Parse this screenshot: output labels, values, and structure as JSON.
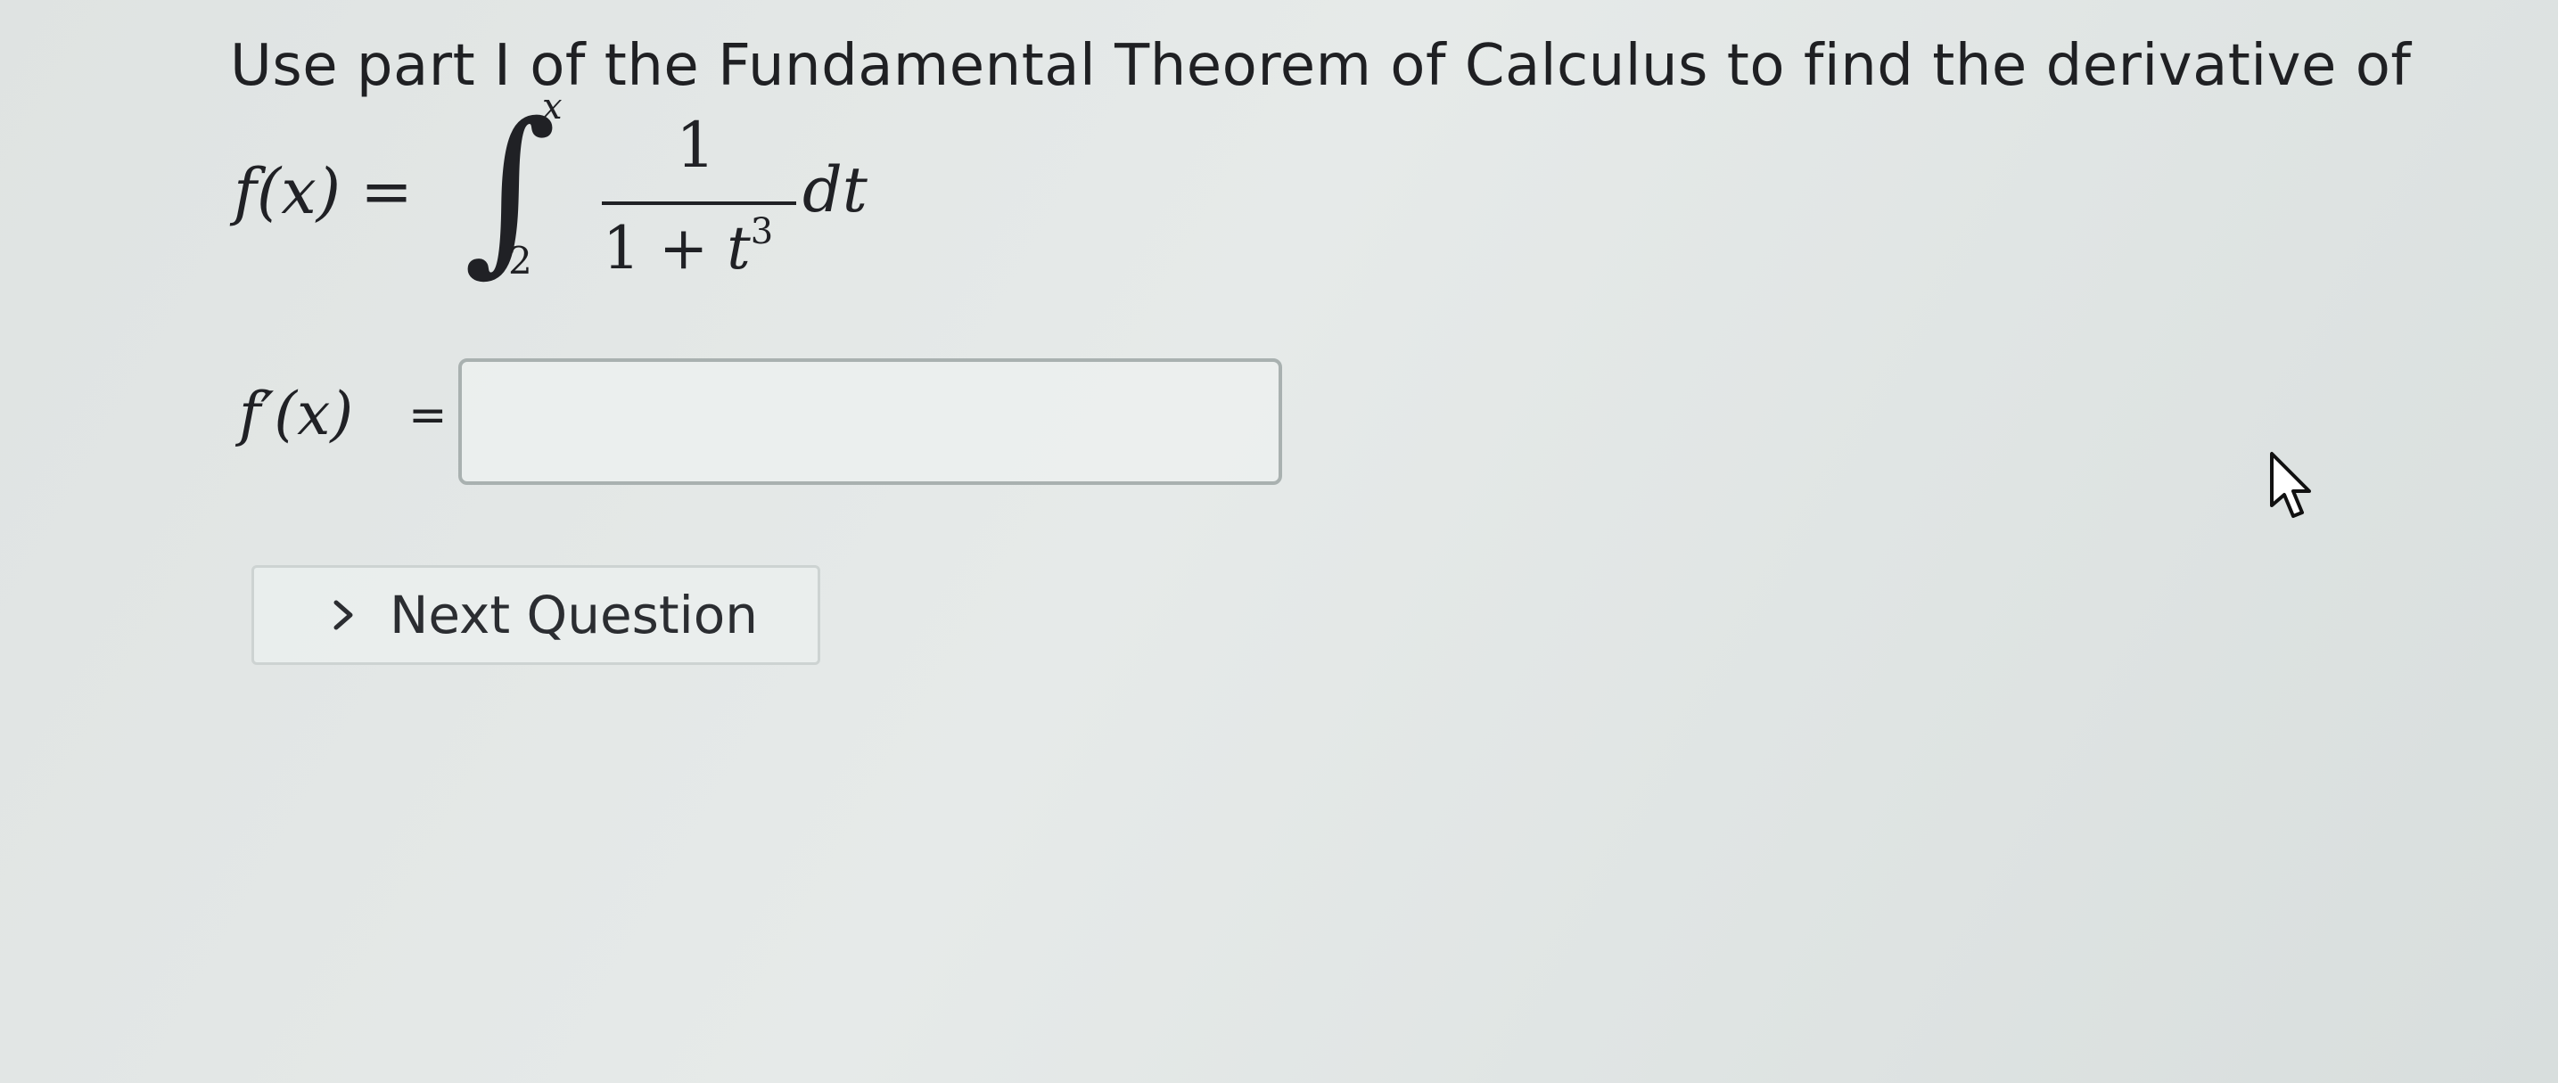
{
  "question": {
    "prompt": "Use part I of the Fundamental Theorem of Calculus to find the derivative of",
    "function_lhs": "f(x) =",
    "integral_symbol": "∫",
    "upper_limit": "x",
    "lower_limit": "2",
    "numerator": "1",
    "denominator_one": "1",
    "denominator_plus": " + ",
    "denominator_var": "t",
    "denominator_exponent": "3",
    "differential": "dt"
  },
  "answer": {
    "label": "f′(x)",
    "equals": "=",
    "value": "",
    "placeholder": ""
  },
  "next_button": {
    "icon": "chevron-right-icon",
    "label": "Next Question"
  },
  "pointer": {
    "icon": "mouse-pointer-icon"
  }
}
